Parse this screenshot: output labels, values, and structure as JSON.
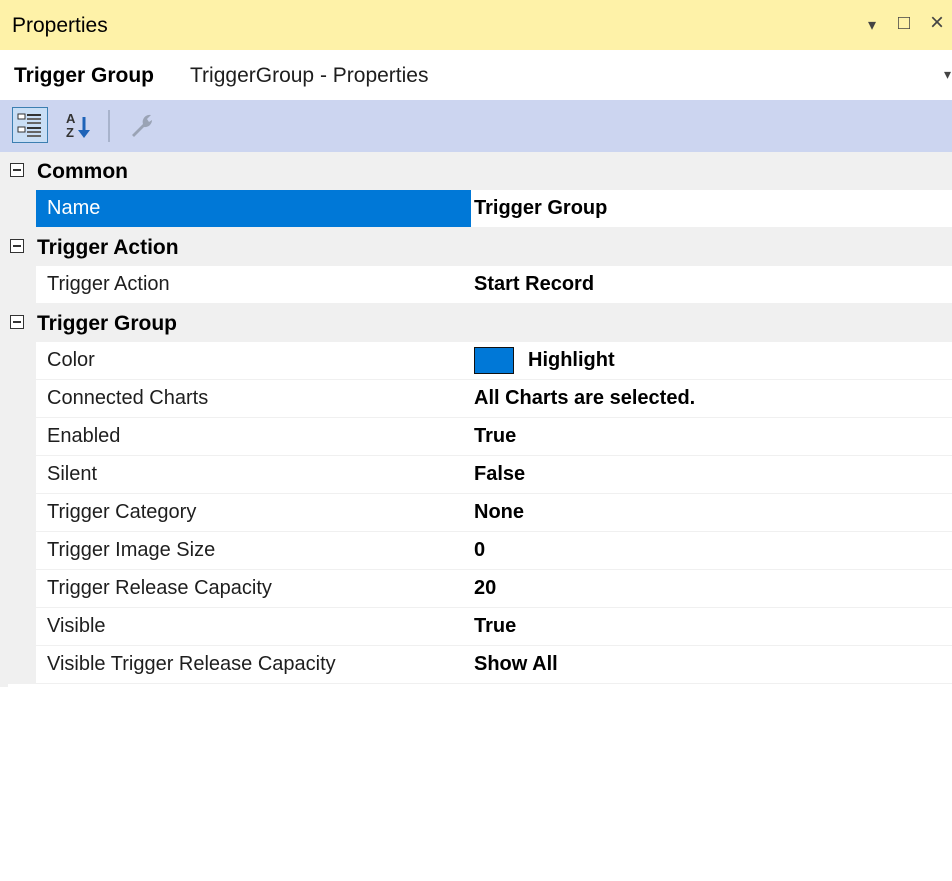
{
  "panel": {
    "title": "Properties",
    "dropdown_glyph": "▾",
    "maximize_glyph": "□",
    "close_glyph": "×"
  },
  "object": {
    "name": "Trigger Group",
    "type": "TriggerGroup - Properties"
  },
  "toolbar": {
    "categorized_icon": "categorized-icon",
    "alphabetical_icon": "alphabetical-icon",
    "property_pages_icon": "wrench-icon"
  },
  "colors": {
    "title_bar": "#fef2a8",
    "toolbar": "#ccd5f0",
    "selection": "#0078d7",
    "swatch": "#0078d7"
  },
  "categories": [
    {
      "label": "Common",
      "properties": [
        {
          "name": "Name",
          "value": "Trigger Group",
          "selected": true
        }
      ]
    },
    {
      "label": "Trigger Action",
      "properties": [
        {
          "name": "Trigger Action",
          "value": "Start Record"
        }
      ]
    },
    {
      "label": "Trigger Group",
      "properties": [
        {
          "name": "Color",
          "value": "Highlight",
          "swatch": "#0078d7"
        },
        {
          "name": "Connected Charts",
          "value": "All Charts are selected."
        },
        {
          "name": "Enabled",
          "value": "True"
        },
        {
          "name": "Silent",
          "value": "False"
        },
        {
          "name": "Trigger Category",
          "value": "None"
        },
        {
          "name": "Trigger Image Size",
          "value": "0"
        },
        {
          "name": "Trigger Release Capacity",
          "value": "20"
        },
        {
          "name": "Visible",
          "value": "True"
        },
        {
          "name": "Visible Trigger Release Capacity",
          "value": "Show All"
        }
      ]
    }
  ]
}
